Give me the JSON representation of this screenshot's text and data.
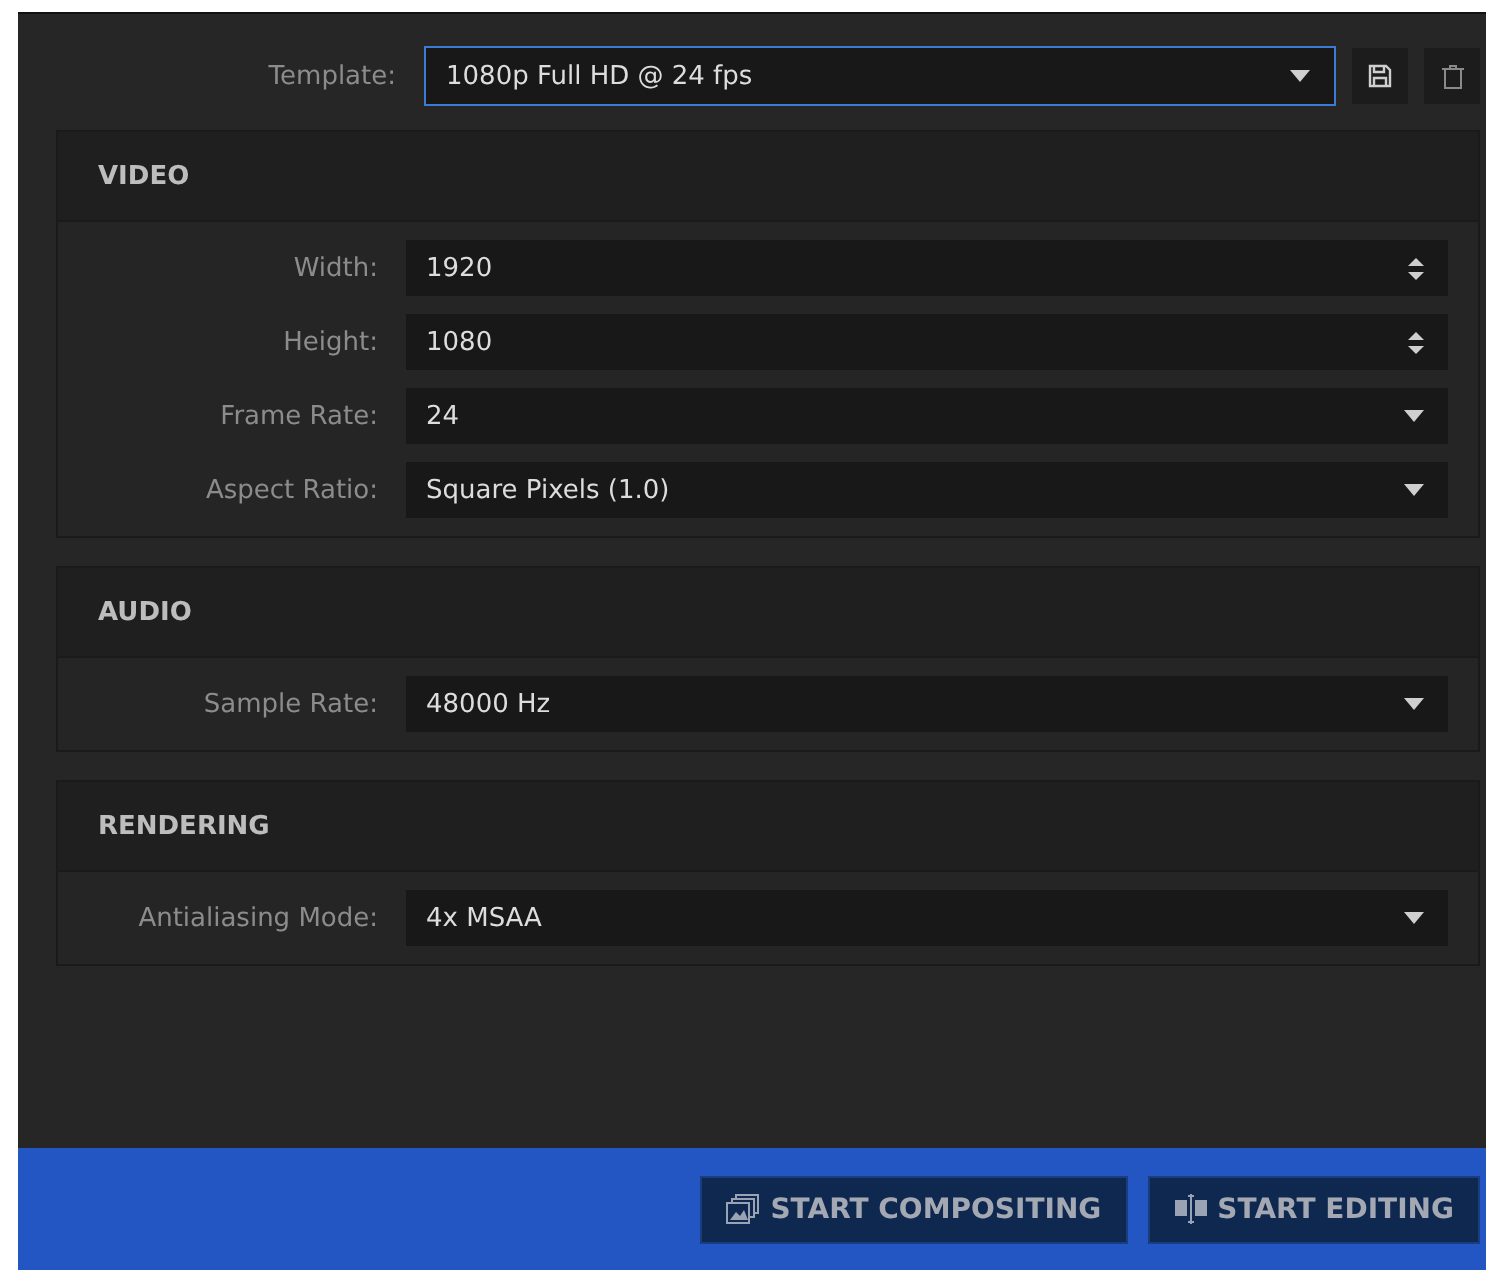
{
  "template": {
    "label": "Template:",
    "value": "1080p Full HD @ 24 fps",
    "focused": true
  },
  "sections": [
    {
      "title": "VIDEO",
      "fields": [
        {
          "label": "Width:",
          "value": "1920",
          "kind": "spinner"
        },
        {
          "label": "Height:",
          "value": "1080",
          "kind": "spinner"
        },
        {
          "label": "Frame Rate:",
          "value": "24",
          "kind": "dropdown"
        },
        {
          "label": "Aspect Ratio:",
          "value": "Square Pixels (1.0)",
          "kind": "dropdown"
        }
      ]
    },
    {
      "title": "AUDIO",
      "fields": [
        {
          "label": "Sample Rate:",
          "value": "48000 Hz",
          "kind": "dropdown"
        }
      ]
    },
    {
      "title": "RENDERING",
      "fields": [
        {
          "label": "Antialiasing Mode:",
          "value": "4x MSAA",
          "kind": "dropdown"
        }
      ]
    }
  ],
  "buttons": [
    {
      "label": "START COMPOSITING",
      "kind": "compositing"
    },
    {
      "label": "START EDITING",
      "kind": "editing"
    }
  ]
}
